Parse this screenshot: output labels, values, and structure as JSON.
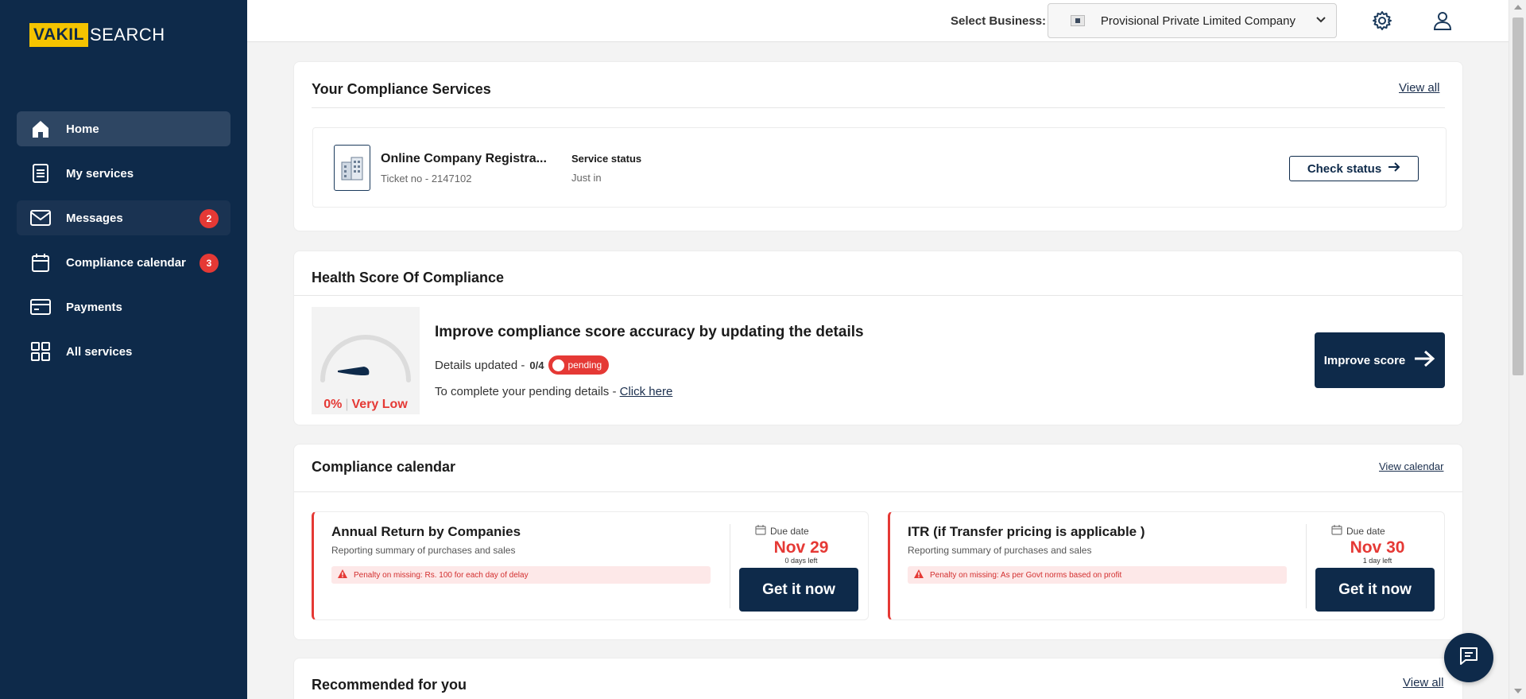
{
  "brand": {
    "part1": "VAKIL",
    "part2": "SEARCH"
  },
  "sidebar": {
    "items": [
      {
        "label": "Home",
        "icon": "home-icon"
      },
      {
        "label": "My services",
        "icon": "document-list-icon"
      },
      {
        "label": "Messages",
        "icon": "mail-icon",
        "badge": "2"
      },
      {
        "label": "Compliance calendar",
        "icon": "calendar-icon",
        "badge": "3"
      },
      {
        "label": "Payments",
        "icon": "card-icon"
      },
      {
        "label": "All services",
        "icon": "grid-icon"
      }
    ]
  },
  "header": {
    "select_label": "Select Business:",
    "business": "Provisional Private Limited Company",
    "icons": [
      "gear-icon",
      "user-icon"
    ]
  },
  "services": {
    "title": "Your Compliance Services",
    "view_all": "View all",
    "item": {
      "name": "Online Company Registra...",
      "ticket": "Ticket no - 2147102",
      "status_label": "Service status",
      "status_value": "Just in",
      "button": "Check status"
    }
  },
  "health": {
    "title": "Health Score Of Compliance",
    "score": "0%",
    "rating": "Very Low",
    "score_fraction": 0,
    "headline": "Improve compliance score accuracy by updating the details",
    "details_label": "Details updated -",
    "details_count": "0/4",
    "pending": "pending",
    "pending_text": "To complete your pending details -",
    "click_here": "Click here",
    "button": "Improve score"
  },
  "calendar": {
    "title": "Compliance calendar",
    "view_link": "View calendar",
    "items": [
      {
        "title": "Annual Return by Companies",
        "subtitle": "Reporting summary of purchases and sales",
        "penalty": "Penalty on missing: Rs. 100 for each day of delay",
        "due_label": "Due date",
        "due_date": "Nov 29",
        "days_left": "0 days left",
        "button": "Get it now"
      },
      {
        "title": "ITR (if Transfer pricing is applicable )",
        "subtitle": "Reporting summary of purchases and sales",
        "penalty": "Penalty on missing: As per Govt norms based on profit",
        "due_label": "Due date",
        "due_date": "Nov 30",
        "days_left": "1 day left",
        "button": "Get it now"
      }
    ]
  },
  "recommended": {
    "title": "Recommended for you",
    "view_all": "View all"
  },
  "colors": {
    "navy": "#0e2a4a",
    "accent_red": "#e53935",
    "brand_yellow": "#f5c400"
  }
}
